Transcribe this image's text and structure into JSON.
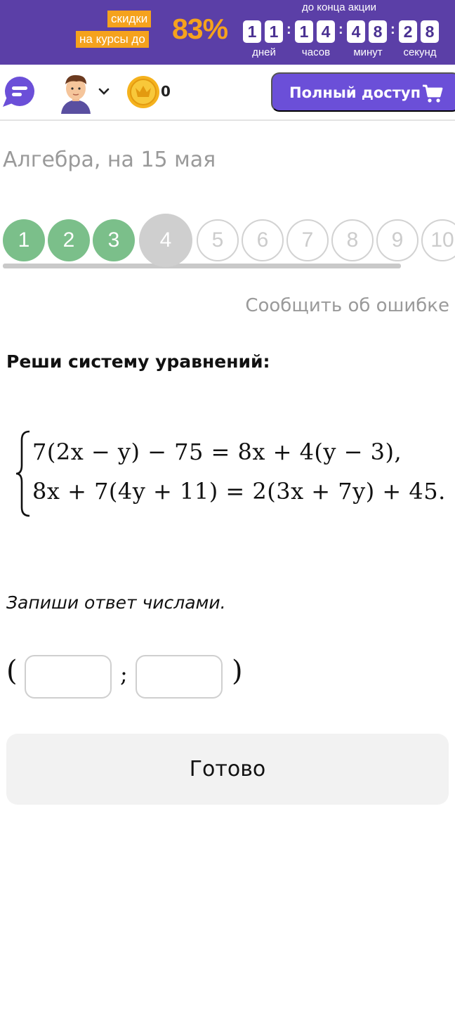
{
  "promo": {
    "tag_line1": "скидки",
    "tag_line2": "на курсы до",
    "percent": "83%",
    "until_label": "до конца акции",
    "timer": {
      "days": [
        "1",
        "1"
      ],
      "hours": [
        "1",
        "4"
      ],
      "minutes": [
        "4",
        "8"
      ],
      "seconds": [
        "2",
        "8"
      ],
      "separator": ":",
      "units": [
        "дней",
        "часов",
        "минут",
        "секунд"
      ]
    },
    "colors": {
      "background": "#5b3fa7",
      "accent": "#f5a21d"
    }
  },
  "header": {
    "menu_icon": "chat-menu-icon",
    "avatar_icon": "user-avatar-icon",
    "coin_icon": "crown-coin-icon",
    "coin_count": "0",
    "full_access_label": "Полный доступ",
    "cart_icon": "cart-icon",
    "colors": {
      "button": "#6b4fd8",
      "menu": "#6b4fd8",
      "coin": "#f5b21d"
    }
  },
  "page": {
    "title": "Алгебра, на 15 мая",
    "report_link": "Сообщить об ошибке"
  },
  "stepper": {
    "steps": [
      {
        "label": "1",
        "state": "done"
      },
      {
        "label": "2",
        "state": "done"
      },
      {
        "label": "3",
        "state": "done"
      },
      {
        "label": "4",
        "state": "current"
      },
      {
        "label": "5",
        "state": "todo"
      },
      {
        "label": "6",
        "state": "todo"
      },
      {
        "label": "7",
        "state": "todo"
      },
      {
        "label": "8",
        "state": "todo"
      },
      {
        "label": "9",
        "state": "todo"
      },
      {
        "label": "10",
        "state": "todo"
      }
    ],
    "colors": {
      "done": "#7bbf8a",
      "current": "#cfcfcf",
      "todo_border": "#d2d2d2"
    }
  },
  "task": {
    "title": "Реши систему уравнений:",
    "equations": [
      "7(2x − y) − 75 = 8x + 4(y − 3),",
      "8x + 7(4y + 11) = 2(3x + 7y) + 45."
    ],
    "answer_hint": "Запиши ответ числами.",
    "answer": {
      "open_paren": "(",
      "separator": ";",
      "close_paren": ")",
      "x_value": "",
      "y_value": ""
    },
    "submit_label": "Готово"
  }
}
